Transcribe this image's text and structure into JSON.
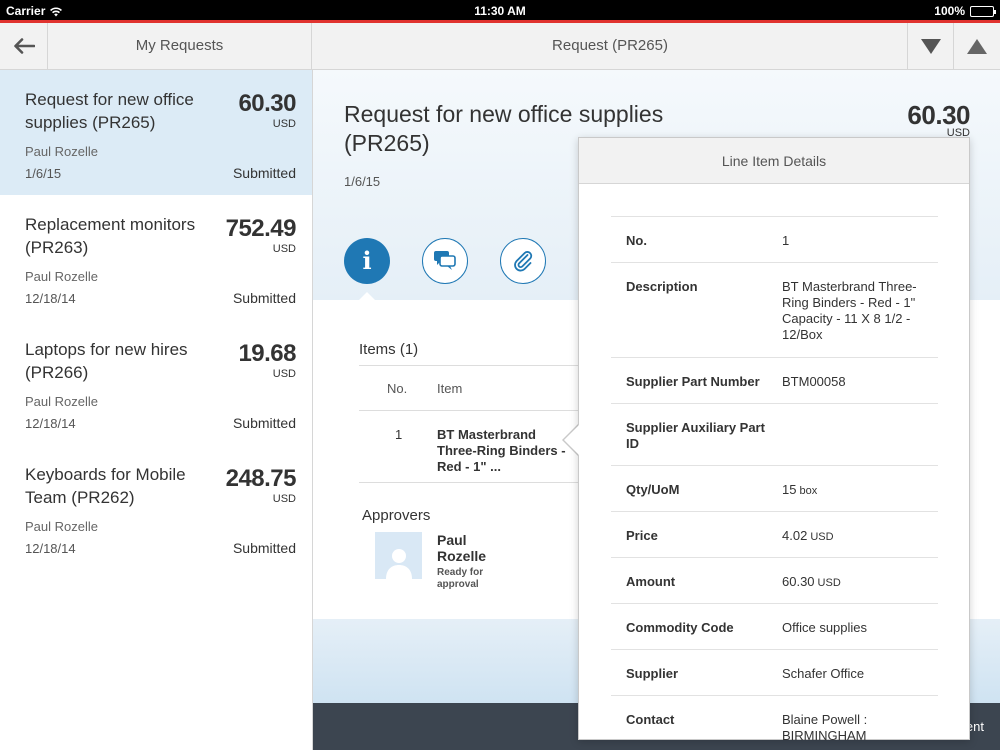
{
  "status_bar": {
    "carrier": "Carrier",
    "time": "11:30 AM",
    "battery": "100%"
  },
  "nav": {
    "left_title": "My Requests",
    "center_title": "Request (PR265)"
  },
  "requests": [
    {
      "title": "Request for new office supplies (PR265)",
      "amount": "60.30",
      "currency": "USD",
      "person": "Paul Rozelle",
      "date": "1/6/15",
      "status": "Submitted"
    },
    {
      "title": "Replacement monitors (PR263)",
      "amount": "752.49",
      "currency": "USD",
      "person": "Paul Rozelle",
      "date": "12/18/14",
      "status": "Submitted"
    },
    {
      "title": "Laptops for new hires (PR266)",
      "amount": "19.68",
      "currency": "USD",
      "person": "Paul Rozelle",
      "date": "12/18/14",
      "status": "Submitted"
    },
    {
      "title": "Keyboards for Mobile Team (PR262)",
      "amount": "248.75",
      "currency": "USD",
      "person": "Paul Rozelle",
      "date": "12/18/14",
      "status": "Submitted"
    }
  ],
  "detail": {
    "title": "Request for new office supplies (PR265)",
    "date": "1/6/15",
    "amount": "60.30",
    "currency": "USD",
    "items_title": "Items (1)",
    "columns": {
      "no": "No.",
      "item": "Item"
    },
    "row": {
      "no": "1",
      "item": "BT Masterbrand Three-Ring Binders - Red - 1\" ..."
    },
    "approvers_title": "Approvers",
    "approver": {
      "name": "Paul Rozelle",
      "status": "Ready for approval"
    },
    "footer_label": "ent"
  },
  "popover": {
    "title": "Line Item Details",
    "rows": [
      {
        "label": "No.",
        "value": "1",
        "unit": ""
      },
      {
        "label": "Description",
        "value": "BT Masterbrand Three-Ring Binders - Red - 1\" Capacity - 11 X 8 1/2 - 12/Box",
        "unit": ""
      },
      {
        "label": "Supplier Part Number",
        "value": "BTM00058",
        "unit": ""
      },
      {
        "label": "Supplier Auxiliary Part ID",
        "value": "",
        "unit": ""
      },
      {
        "label": "Qty/UoM",
        "value": "15",
        "unit": "box"
      },
      {
        "label": "Price",
        "value": "4.02",
        "unit": "USD"
      },
      {
        "label": "Amount",
        "value": "60.30",
        "unit": "USD"
      },
      {
        "label": "Commodity Code",
        "value": "Office supplies",
        "unit": ""
      },
      {
        "label": "Supplier",
        "value": "Schafer Office",
        "unit": ""
      },
      {
        "label": "Contact",
        "value": "Blaine Powell : BIRMINGHAM",
        "unit": ""
      }
    ]
  },
  "colors": {
    "accent": "#1f78b4",
    "status_red": "#e0332f",
    "selected_bg": "#dcebf6",
    "footer": "#3c4550"
  }
}
